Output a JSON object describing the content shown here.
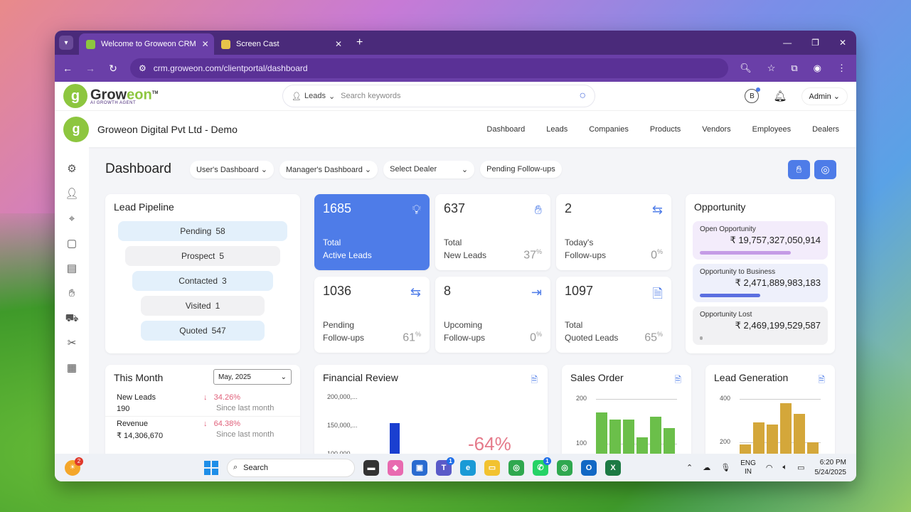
{
  "browser": {
    "tabs": [
      {
        "title": "Welcome to Groweon CRM",
        "active": true
      },
      {
        "title": "Screen Cast",
        "active": false
      }
    ],
    "url": "crm.groweon.com/clientportal/dashboard"
  },
  "header": {
    "logo_text_a": "Grow",
    "logo_text_b": "eon",
    "logo_tm": "TM",
    "logo_tagline": "AI GROWTH AGENT",
    "search_entity": "Leads",
    "search_placeholder": "Search keywords",
    "user": "Admin",
    "badge_letter": "B"
  },
  "company": {
    "name": "Groweon Digital Pvt Ltd - Demo",
    "menu": [
      "Dashboard",
      "Leads",
      "Companies",
      "Products",
      "Vendors",
      "Employees",
      "Dealers"
    ]
  },
  "dashboard": {
    "title": "Dashboard",
    "filters": {
      "users_dashboard": "User's Dashboard",
      "managers_dashboard": "Manager's Dashboard",
      "dealer_select": "Select Dealer",
      "pending_followups": "Pending Follow-ups"
    }
  },
  "lead_pipeline": {
    "title": "Lead Pipeline",
    "stages": [
      {
        "label": "Pending",
        "count": "58"
      },
      {
        "label": "Prospect",
        "count": "5"
      },
      {
        "label": "Contacted",
        "count": "3"
      },
      {
        "label": "Visited",
        "count": "1"
      },
      {
        "label": "Quoted",
        "count": "547"
      }
    ]
  },
  "stats": [
    {
      "value": "1685",
      "line1": "Total",
      "line2": "Active Leads",
      "pct": ""
    },
    {
      "value": "637",
      "line1": "Total",
      "line2": "New Leads",
      "pct": "37"
    },
    {
      "value": "2",
      "line1": "Today's",
      "line2": "Follow-ups",
      "pct": "0"
    },
    {
      "value": "1036",
      "line1": "Pending",
      "line2": "Follow-ups",
      "pct": "61"
    },
    {
      "value": "8",
      "line1": "Upcoming",
      "line2": "Follow-ups",
      "pct": "0"
    },
    {
      "value": "1097",
      "line1": "Total",
      "line2": "Quoted Leads",
      "pct": "65"
    }
  ],
  "percent_sign": "%",
  "opportunity": {
    "title": "Opportunity",
    "items": [
      {
        "label": "Open Opportunity",
        "value": "₹ 19,757,327,050,914",
        "fill": 0.75,
        "color": "#c59be6",
        "bg": "#f3ecfb"
      },
      {
        "label": "Opportunity to Business",
        "value": "₹ 2,471,889,983,183",
        "fill": 0.5,
        "color": "#5b6fe0",
        "bg": "#eef0fb"
      },
      {
        "label": "Opportunity Lost",
        "value": "₹ 2,469,199,529,587",
        "fill": 0.02,
        "color": "#aaa",
        "bg": "#f1f1f3"
      }
    ]
  },
  "this_month": {
    "title": "This Month",
    "selected_month": "May, 2025",
    "rows": [
      {
        "label": "New Leads",
        "value": "190",
        "change": "34.26%",
        "since": "Since last month"
      },
      {
        "label": "Revenue",
        "value": "₹ 14,306,670",
        "change": "64.38%",
        "since": "Since last month"
      }
    ]
  },
  "financial_review": {
    "title": "Financial Review",
    "change_label": "-64%"
  },
  "sales_order": {
    "title": "Sales Order"
  },
  "lead_generation": {
    "title": "Lead Generation"
  },
  "chart_data": [
    {
      "type": "bar",
      "title": "Financial Review",
      "y_ticks": [
        "200,000,...",
        "150,000,...",
        "100,000,..."
      ],
      "values": [
        155000
      ],
      "ylim": [
        95000,
        205000
      ],
      "colors": [
        "#1a3fd0"
      ]
    },
    {
      "type": "bar",
      "title": "Sales Order",
      "y_ticks": [
        "200",
        "100"
      ],
      "values": [
        170,
        155,
        155,
        115,
        160,
        135
      ],
      "ylim": [
        70,
        210
      ],
      "colors": [
        "#6bbf4a"
      ]
    },
    {
      "type": "bar",
      "title": "Lead Generation",
      "y_ticks": [
        "400",
        "200"
      ],
      "values": [
        190,
        290,
        280,
        380,
        330,
        200
      ],
      "ylim": [
        130,
        420
      ],
      "colors": [
        "#d4a73a"
      ]
    }
  ],
  "taskbar": {
    "search_label": "Search",
    "language": "ENG",
    "region": "IN",
    "time": "6:20 PM",
    "date": "5/24/2025",
    "weather_badge": "2"
  }
}
